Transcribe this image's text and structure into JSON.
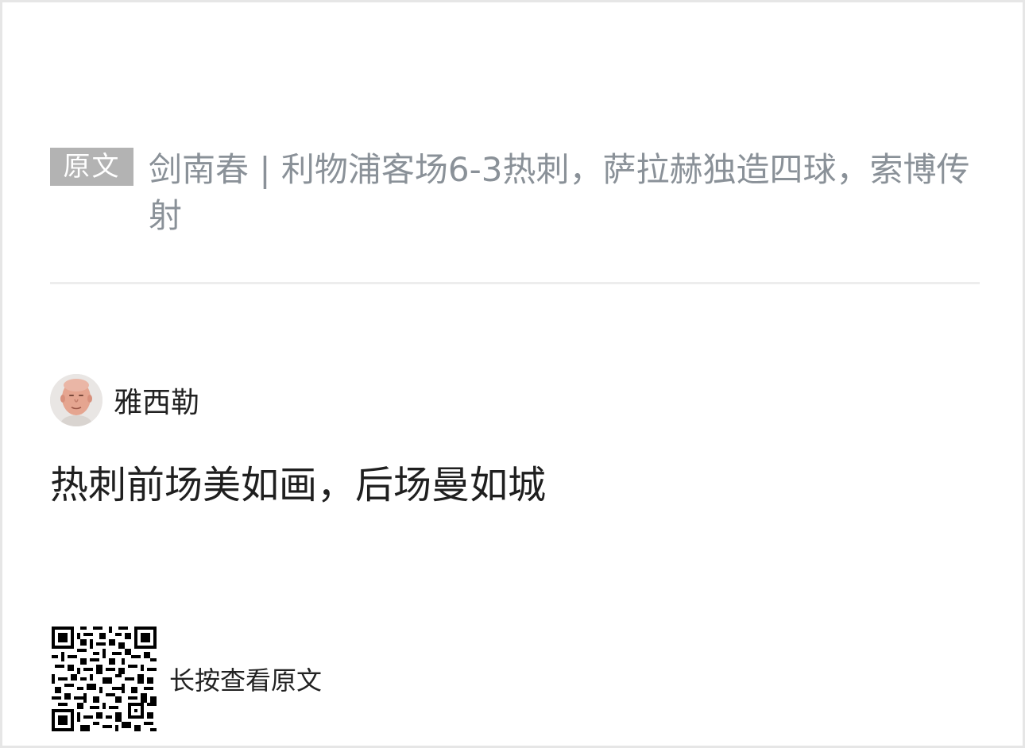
{
  "source": {
    "badge_label": "原文",
    "title": "剑南春 | 利物浦客场6-3热刺，萨拉赫独造四球，索博传射"
  },
  "author": {
    "avatar_icon": "person-avatar-icon",
    "name": "雅西勒"
  },
  "comment": {
    "text": "热刺前场美如画，后场曼如城"
  },
  "footer": {
    "qr_icon": "qr-code-icon",
    "label": "长按查看原文"
  },
  "colors": {
    "badge_bg": "#b3b3b3",
    "title_text": "#8a9198",
    "body_text": "#1f1f1f",
    "border": "#e6e6e6"
  }
}
